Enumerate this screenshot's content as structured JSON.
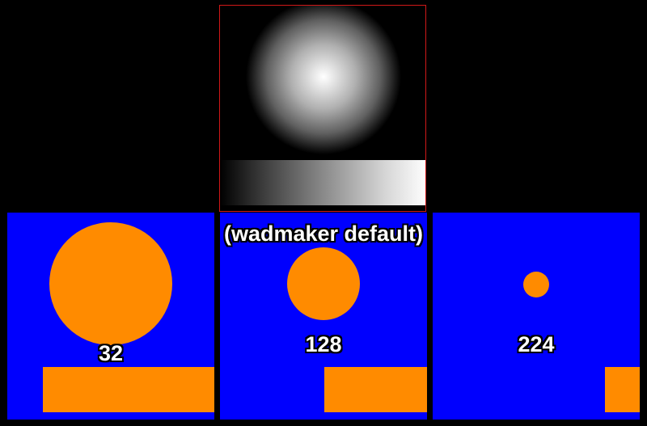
{
  "source_image": {
    "border_color": "#d01818"
  },
  "caption": "(wadmaker default)",
  "panels": [
    {
      "label": "32",
      "background": "#0000fe",
      "shape_color": "#ff8b00"
    },
    {
      "label": "128",
      "background": "#0000fe",
      "shape_color": "#ff8b00"
    },
    {
      "label": "224",
      "background": "#0000fe",
      "shape_color": "#ff8b00"
    }
  ]
}
